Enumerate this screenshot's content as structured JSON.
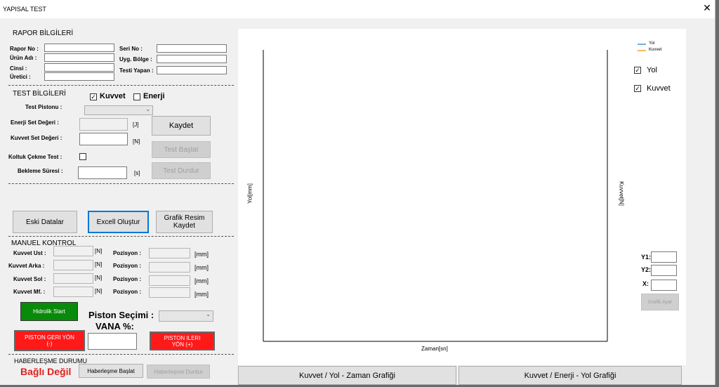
{
  "window": {
    "title": "YAPISAL TEST",
    "close_glyph": "✕"
  },
  "rapor": {
    "heading": "RAPOR BİLGİLERİ",
    "rapor_no": "Rapor No :",
    "urun_adi": "Ürün Adı :",
    "cinsi": "Cinsi :",
    "uretici": "Üretici :",
    "seri_no": "Seri No :",
    "uyg_bolge": "Uyg. Bölge :",
    "testi_yapan": "Testi Yapan :"
  },
  "test": {
    "heading": "TEST BİLGİLERİ",
    "kuvvet_cb": "Kuvvet",
    "kuvvet_checked": true,
    "enerji_cb": "Enerji",
    "enerji_checked": false,
    "test_pistonu": "Test Pistonu :",
    "enerji_set": "Enerji Set Değeri :",
    "kuvvet_set": "Kuvvet Set Değeri :",
    "koltuk": "Koltuk Çekme Test :",
    "bekleme": "Bekleme Süresi :",
    "unit_j": "[J]",
    "unit_n": "[N]",
    "unit_s": "[s]",
    "kaydet": "Kaydet",
    "test_baslat": "Test Başlat",
    "test_durdur": "Test Durdur"
  },
  "actions": {
    "eski": "Eski Datalar",
    "excel": "Excell Oluştur",
    "grafik_resim_1": "Grafik Resim",
    "grafik_resim_2": "Kaydet"
  },
  "manuel": {
    "heading": "MANUEL KONTROL",
    "rows": [
      {
        "label": "Kuvvet Ust :",
        "unit": "[N]",
        "pos": "Pozisyon :",
        "pos_unit": "[mm]"
      },
      {
        "label": "Kuvvet Arka :",
        "unit": "[N]",
        "pos": "Pozisyon :",
        "pos_unit": "[mm]"
      },
      {
        "label": "Kuvvet Sol :",
        "unit": "[N]",
        "pos": "Pozisyon :",
        "pos_unit": "[mm]"
      },
      {
        "label": "Kuvvet Mf. :",
        "unit": "[N]",
        "pos": "Pozisyon :",
        "pos_unit": "[mm]"
      }
    ],
    "hidrolik": "Hidrolik Start",
    "piston_secimi": "Piston Seçimi :",
    "vana": "VANA %:",
    "geri_1": "PISTON GERI YÖN",
    "geri_2": "(-)",
    "ileri_1": "PISTON ILERI",
    "ileri_2": "YÖN (+)"
  },
  "haberlesme": {
    "heading": "HABERLEŞME DURUMU",
    "status": "Bağlı Değil",
    "baslat": "Haberleşme Başlat",
    "durdur": "Haberleşme Durdur"
  },
  "chart_panel": {
    "legend_yol": "Yol",
    "legend_kuvvet": "Kuvvet",
    "cb_yol": "Yol",
    "cb_yol_checked": true,
    "cb_kuvvet": "Kuvvet",
    "cb_kuvvet_checked": true,
    "y1": "Y1:",
    "y2": "Y2:",
    "x": "X:",
    "grafik_ayar": "Grafik Ayar"
  },
  "chart_data": {
    "type": "line",
    "xlabel": "Zaman[sn]",
    "ylabel": "Yol[mm]",
    "y2label": "Kuvvet[N]",
    "series": [
      {
        "name": "Yol",
        "color": "#4a90d9",
        "values": []
      },
      {
        "name": "Kuvvet",
        "color": "#f0a030",
        "values": []
      }
    ]
  },
  "tabs": {
    "tab1": "Kuvvet / Yol - Zaman Grafiği",
    "tab2": "Kuvvet / Enerji - Yol Grafiği"
  },
  "colors": {
    "green": "#0a8a0a",
    "red": "#ff1a1a",
    "status_red": "#e02020"
  }
}
